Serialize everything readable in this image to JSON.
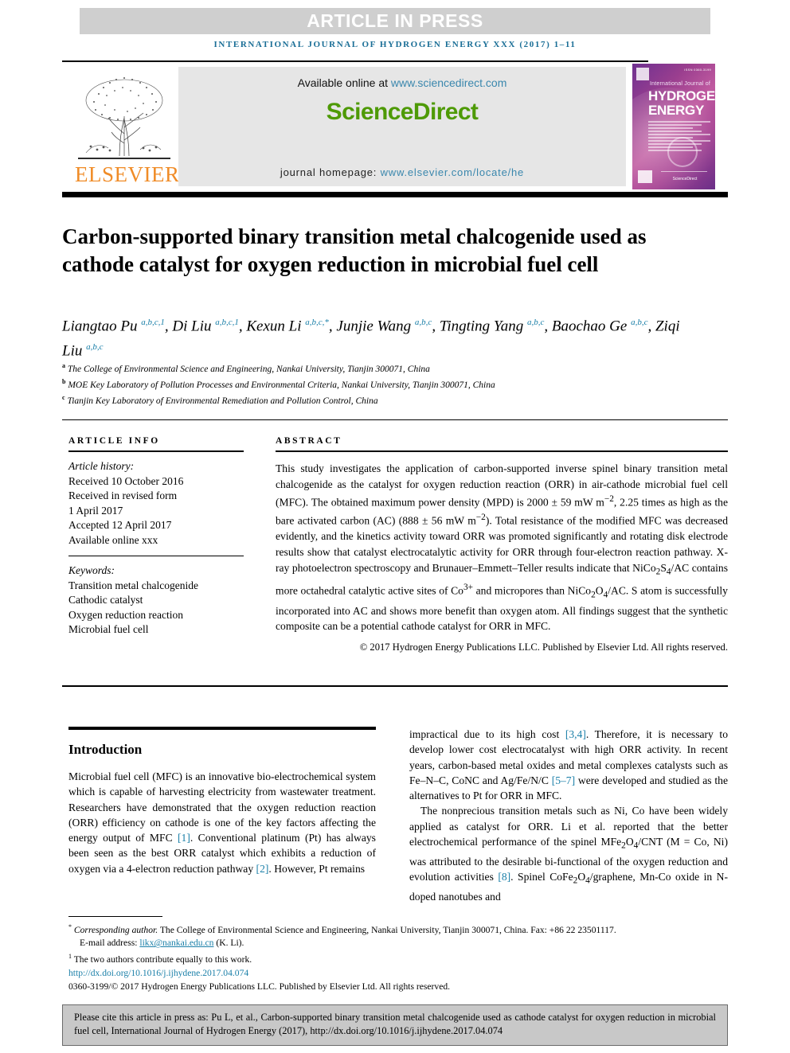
{
  "banner": {
    "article_in_press": "ARTICLE IN PRESS",
    "running_head": "INTERNATIONAL JOURNAL OF HYDROGEN ENERGY XXX (2017) 1–11"
  },
  "masthead": {
    "publisher": "ELSEVIER",
    "available_prefix": "Available online at ",
    "available_url": "www.sciencedirect.com",
    "sciencedirect_science": "Science",
    "sciencedirect_direct": "Direct",
    "homepage_prefix": "journal homepage: ",
    "homepage_url": "www.elsevier.com/locate/he",
    "cover": {
      "issn": "ISSN 0360-3199",
      "small_title": "International Journal of",
      "big_line1": "HYDROGEN",
      "big_line2": "ENERGY",
      "foot_text": "ScienceDirect"
    }
  },
  "article": {
    "title": "Carbon-supported binary transition metal chalcogenide used as cathode catalyst for oxygen reduction in microbial fuel cell",
    "authors": [
      {
        "name": "Liangtao Pu",
        "sup": "a,b,c,1",
        "sep": ", "
      },
      {
        "name": "Di Liu",
        "sup": "a,b,c,1",
        "sep": ", "
      },
      {
        "name": "Kexun Li",
        "sup": "a,b,c,*",
        "sep": ", "
      },
      {
        "name": "Junjie Wang",
        "sup": "a,b,c",
        "sep": ", "
      },
      {
        "name": "Tingting Yang",
        "sup": "a,b,c",
        "sep": ", "
      },
      {
        "name": "Baochao Ge",
        "sup": "a,b,c",
        "sep": ", "
      },
      {
        "name": "Ziqi Liu",
        "sup": "a,b,c",
        "sep": ""
      }
    ],
    "affiliations": [
      {
        "mark": "a",
        "text": "The College of Environmental Science and Engineering, Nankai University, Tianjin 300071, China"
      },
      {
        "mark": "b",
        "text": "MOE Key Laboratory of Pollution Processes and Environmental Criteria, Nankai University, Tianjin 300071, China"
      },
      {
        "mark": "c",
        "text": "Tianjin Key Laboratory of Environmental Remediation and Pollution Control, China"
      }
    ]
  },
  "article_info": {
    "heading": "ARTICLE INFO",
    "history_label": "Article history:",
    "history": [
      "Received 10 October 2016",
      "Received in revised form",
      "1 April 2017",
      "Accepted 12 April 2017",
      "Available online xxx"
    ],
    "keywords_label": "Keywords:",
    "keywords": [
      "Transition metal chalcogenide",
      "Cathodic catalyst",
      "Oxygen reduction reaction",
      "Microbial fuel cell"
    ]
  },
  "abstract": {
    "heading": "ABSTRACT",
    "text": "This study investigates the application of carbon-supported inverse spinel binary transition metal chalcogenide as the catalyst for oxygen reduction reaction (ORR) in air-cathode microbial fuel cell (MFC). The obtained maximum power density (MPD) is 2000 ± 59 mW m−2, 2.25 times as high as the bare activated carbon (AC) (888 ± 56 mW m−2). Total resistance of the modified MFC was decreased evidently, and the kinetics activity toward ORR was promoted significantly and rotating disk electrode results show that catalyst electrocatalytic activity for ORR through four-electron reaction pathway. X-ray photoelectron spectroscopy and Brunauer–Emmett–Teller results indicate that NiCo2S4/AC contains more octahedral catalytic active sites of Co3+ and micropores than NiCo2O4/AC. S atom is successfully incorporated into AC and shows more benefit than oxygen atom. All findings suggest that the synthetic composite can be a potential cathode catalyst for ORR in MFC.",
    "copyright": "© 2017 Hydrogen Energy Publications LLC. Published by Elsevier Ltd. All rights reserved."
  },
  "introduction": {
    "heading": "Introduction",
    "left_paragraph": "Microbial fuel cell (MFC) is an innovative bio-electrochemical system which is capable of harvesting electricity from wastewater treatment. Researchers have demonstrated that the oxygen reduction reaction (ORR) efficiency on cathode is one of the key factors affecting the energy output of MFC [1]. Conventional platinum (Pt) has always been seen as the best ORR catalyst which exhibits a reduction of oxygen via a 4-electron reduction pathway [2]. However, Pt remains",
    "right_paragraph_1": "impractical due to its high cost [3,4]. Therefore, it is necessary to develop lower cost electrocatalyst with high ORR activity. In recent years, carbon-based metal oxides and metal complexes catalysts such as Fe–N–C, CoNC and Ag/Fe/N/C [5–7] were developed and studied as the alternatives to Pt for ORR in MFC.",
    "right_paragraph_2": "The nonprecious transition metals such as Ni, Co have been widely applied as catalyst for ORR. Li et al. reported that the better electrochemical performance of the spinel MFe2O4/CNT (M = Co, Ni) was attributed to the desirable bi-functional of the oxygen reduction and evolution activities [8]. Spinel CoFe2O4/graphene, Mn-Co oxide in N-doped nanotubes and"
  },
  "footnotes": {
    "corresponding_mark": "*",
    "corresponding_label": "Corresponding author.",
    "corresponding_text": " The College of Environmental Science and Engineering, Nankai University, Tianjin 300071, China. Fax: +86 22 23501117.",
    "email_label": "E-mail address: ",
    "email_address": "likx@nankai.edu.cn",
    "email_suffix": " (K. Li).",
    "equal_mark": "1",
    "equal_text": " The two authors contribute equally to this work.",
    "doi": "http://dx.doi.org/10.1016/j.ijhydene.2017.04.074",
    "issn_copyright": "0360-3199/© 2017 Hydrogen Energy Publications LLC. Published by Elsevier Ltd. All rights reserved."
  },
  "citation_box": {
    "text": "Please cite this article in press as: Pu L, et al., Carbon-supported binary transition metal chalcogenide used as cathode catalyst for oxygen reduction in microbial fuel cell, International Journal of Hydrogen Energy (2017), http://dx.doi.org/10.1016/j.ijhydene.2017.04.074"
  },
  "colors": {
    "link": "#1a7fa8",
    "running_head": "#1a6e96",
    "sciencedirect_green": "#4e9a06",
    "elsevier_orange": "#f08c28",
    "banner_gray": "#cfcfcf",
    "citebox_gray": "#c8c8c8"
  }
}
